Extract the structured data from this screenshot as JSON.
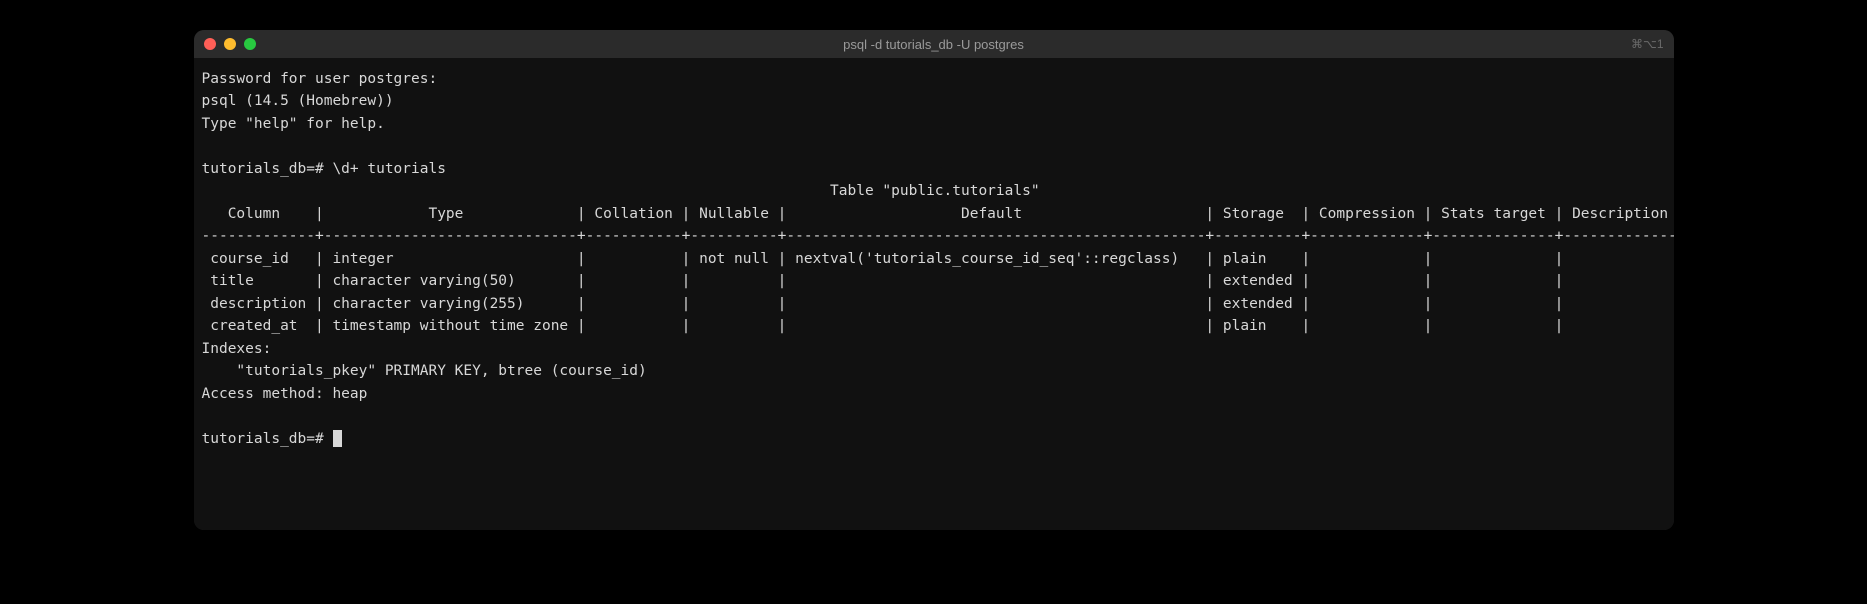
{
  "window": {
    "title": "psql -d tutorials_db -U postgres",
    "shortcut": "⌘⌥1"
  },
  "session": {
    "password_prompt": "Password for user postgres:",
    "version_line": "psql (14.5 (Homebrew))",
    "help_line": "Type \"help\" for help.",
    "prompt": "tutorials_db=#",
    "command": "\\d+ tutorials"
  },
  "table": {
    "title": "Table \"public.tutorials\"",
    "headers": [
      "Column",
      "Type",
      "Collation",
      "Nullable",
      "Default",
      "Storage",
      "Compression",
      "Stats target",
      "Description"
    ],
    "rows": [
      {
        "column": "course_id",
        "type": "integer",
        "collation": "",
        "nullable": "not null",
        "default": "nextval('tutorials_course_id_seq'::regclass)",
        "storage": "plain",
        "compression": "",
        "stats_target": "",
        "description": ""
      },
      {
        "column": "title",
        "type": "character varying(50)",
        "collation": "",
        "nullable": "",
        "default": "",
        "storage": "extended",
        "compression": "",
        "stats_target": "",
        "description": ""
      },
      {
        "column": "description",
        "type": "character varying(255)",
        "collation": "",
        "nullable": "",
        "default": "",
        "storage": "extended",
        "compression": "",
        "stats_target": "",
        "description": ""
      },
      {
        "column": "created_at",
        "type": "timestamp without time zone",
        "collation": "",
        "nullable": "",
        "default": "",
        "storage": "plain",
        "compression": "",
        "stats_target": "",
        "description": ""
      }
    ],
    "indexes_label": "Indexes:",
    "index_line": "    \"tutorials_pkey\" PRIMARY KEY, btree (course_id)",
    "access_method": "Access method: heap"
  },
  "widths": {
    "column": 13,
    "type": 29,
    "collation": 11,
    "nullable": 10,
    "default": 48,
    "storage": 10,
    "compression": 13,
    "stats_target": 14,
    "description": 13
  }
}
